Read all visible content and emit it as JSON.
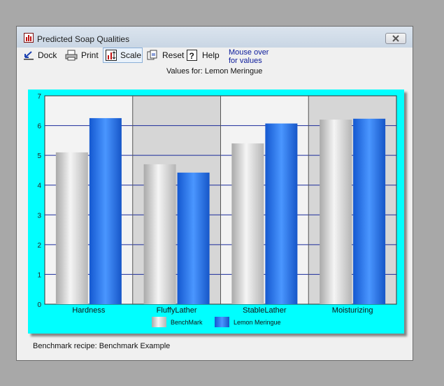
{
  "window": {
    "title": "Predicted Soap Qualities"
  },
  "toolbar": {
    "dock_label": "Dock",
    "print_label": "Print",
    "scale_label": "Scale",
    "reset_label": "Reset",
    "help_label": "Help",
    "hint_line1": "Mouse over",
    "hint_line2": "for values"
  },
  "values_for": "Values for:  Lemon Meringue",
  "status": "Benchmark recipe: Benchmark Example",
  "colors": {
    "panel": "#00ffff",
    "benchmark": "#c8c8c8",
    "recipe": "#2f7ff0",
    "gridline": "#1a2a9a"
  },
  "chart_data": {
    "type": "bar",
    "categories": [
      "Hardness",
      "FluffyLather",
      "StableLather",
      "Moisturizing"
    ],
    "value_labels": [
      "6.2",
      "4.4",
      "6.1",
      "6.2"
    ],
    "yticks": [
      "0",
      "1",
      "2",
      "3",
      "4",
      "5",
      "6",
      "7"
    ],
    "ylim": [
      0,
      7
    ],
    "grid": true,
    "legend_position": "bottom",
    "series": [
      {
        "name": "BenchMark",
        "values": [
          5.1,
          4.7,
          5.4,
          6.2
        ]
      },
      {
        "name": "Lemon Meringue",
        "values": [
          6.25,
          4.42,
          6.07,
          6.23
        ]
      }
    ]
  }
}
